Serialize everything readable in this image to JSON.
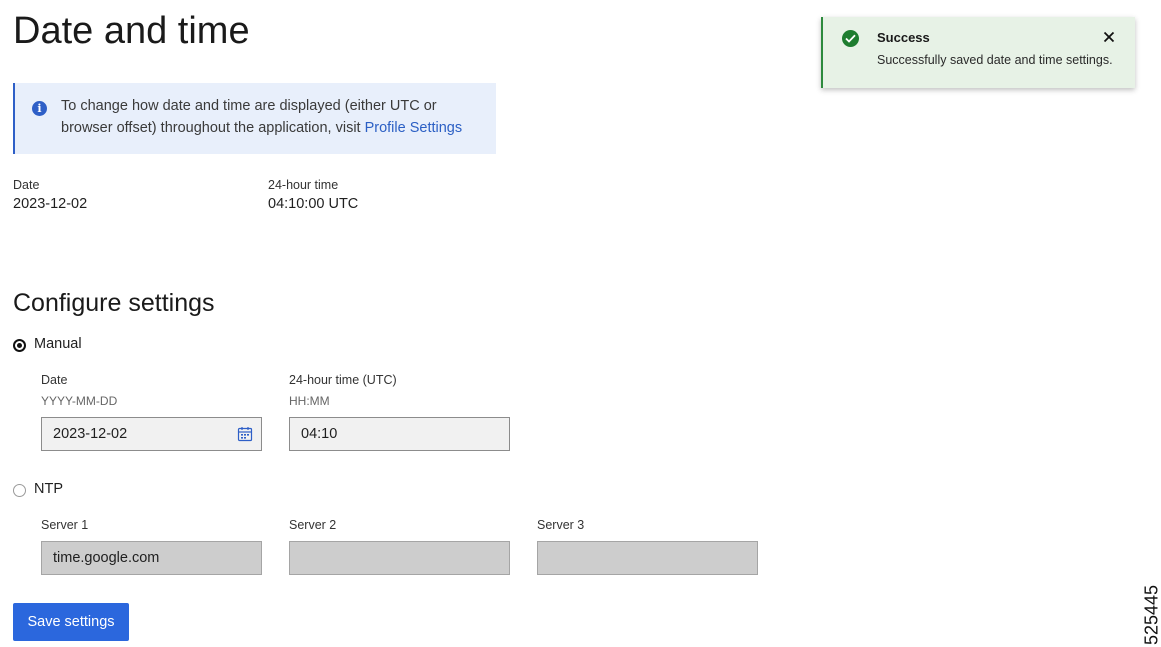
{
  "page": {
    "title": "Date and time",
    "info": {
      "text": "To change how date and time are displayed (either UTC or browser offset) throughout the application, visit ",
      "link_label": "Profile Settings"
    },
    "current": {
      "date_label": "Date",
      "date_value": "2023-12-02",
      "time_label": "24-hour time",
      "time_value": "04:10:00 UTC"
    }
  },
  "configure": {
    "title": "Configure settings",
    "manual": {
      "label": "Manual",
      "selected": true,
      "date_label": "Date",
      "date_hint": "YYYY-MM-DD",
      "date_value": "2023-12-02",
      "time_label": "24-hour time (UTC)",
      "time_hint": "HH:MM",
      "time_value": "04:10"
    },
    "ntp": {
      "label": "NTP",
      "selected": false,
      "servers": [
        {
          "label": "Server 1",
          "value": "time.google.com"
        },
        {
          "label": "Server 2",
          "value": ""
        },
        {
          "label": "Server 3",
          "value": ""
        }
      ]
    },
    "save_label": "Save settings"
  },
  "toast": {
    "title": "Success",
    "message": "Successfully saved date and time settings."
  },
  "figure_id": "525445",
  "colors": {
    "accent": "#2b67dd",
    "info_bg": "#e8effb",
    "success_bg": "#e7f2e6",
    "success": "#1e7d2f"
  },
  "icons": {
    "info": "info-icon",
    "calendar": "calendar-icon",
    "success": "check-circle-icon",
    "close": "close-icon"
  }
}
